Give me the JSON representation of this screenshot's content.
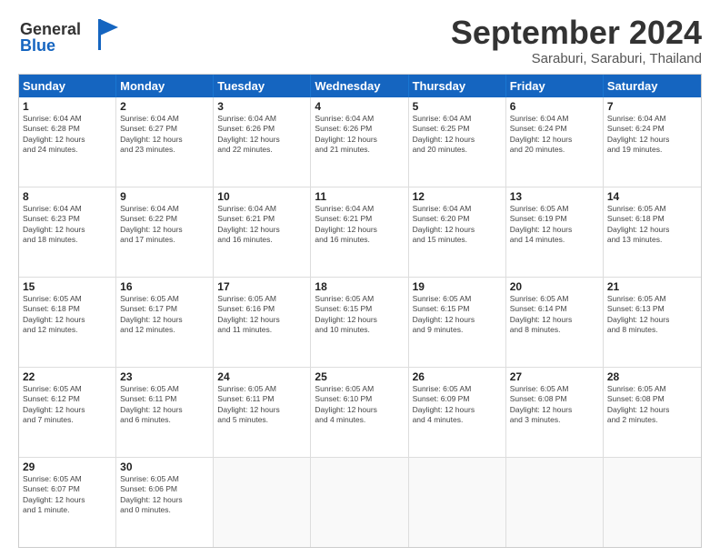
{
  "header": {
    "logo_line1": "General",
    "logo_line2": "Blue",
    "month": "September 2024",
    "location": "Saraburi, Saraburi, Thailand"
  },
  "weekdays": [
    "Sunday",
    "Monday",
    "Tuesday",
    "Wednesday",
    "Thursday",
    "Friday",
    "Saturday"
  ],
  "rows": [
    [
      {
        "day": "",
        "text": ""
      },
      {
        "day": "2",
        "text": "Sunrise: 6:04 AM\nSunset: 6:27 PM\nDaylight: 12 hours\nand 23 minutes."
      },
      {
        "day": "3",
        "text": "Sunrise: 6:04 AM\nSunset: 6:26 PM\nDaylight: 12 hours\nand 22 minutes."
      },
      {
        "day": "4",
        "text": "Sunrise: 6:04 AM\nSunset: 6:26 PM\nDaylight: 12 hours\nand 21 minutes."
      },
      {
        "day": "5",
        "text": "Sunrise: 6:04 AM\nSunset: 6:25 PM\nDaylight: 12 hours\nand 20 minutes."
      },
      {
        "day": "6",
        "text": "Sunrise: 6:04 AM\nSunset: 6:24 PM\nDaylight: 12 hours\nand 20 minutes."
      },
      {
        "day": "7",
        "text": "Sunrise: 6:04 AM\nSunset: 6:24 PM\nDaylight: 12 hours\nand 19 minutes."
      }
    ],
    [
      {
        "day": "8",
        "text": "Sunrise: 6:04 AM\nSunset: 6:23 PM\nDaylight: 12 hours\nand 18 minutes."
      },
      {
        "day": "9",
        "text": "Sunrise: 6:04 AM\nSunset: 6:22 PM\nDaylight: 12 hours\nand 17 minutes."
      },
      {
        "day": "10",
        "text": "Sunrise: 6:04 AM\nSunset: 6:21 PM\nDaylight: 12 hours\nand 16 minutes."
      },
      {
        "day": "11",
        "text": "Sunrise: 6:04 AM\nSunset: 6:21 PM\nDaylight: 12 hours\nand 16 minutes."
      },
      {
        "day": "12",
        "text": "Sunrise: 6:04 AM\nSunset: 6:20 PM\nDaylight: 12 hours\nand 15 minutes."
      },
      {
        "day": "13",
        "text": "Sunrise: 6:05 AM\nSunset: 6:19 PM\nDaylight: 12 hours\nand 14 minutes."
      },
      {
        "day": "14",
        "text": "Sunrise: 6:05 AM\nSunset: 6:18 PM\nDaylight: 12 hours\nand 13 minutes."
      }
    ],
    [
      {
        "day": "15",
        "text": "Sunrise: 6:05 AM\nSunset: 6:18 PM\nDaylight: 12 hours\nand 12 minutes."
      },
      {
        "day": "16",
        "text": "Sunrise: 6:05 AM\nSunset: 6:17 PM\nDaylight: 12 hours\nand 12 minutes."
      },
      {
        "day": "17",
        "text": "Sunrise: 6:05 AM\nSunset: 6:16 PM\nDaylight: 12 hours\nand 11 minutes."
      },
      {
        "day": "18",
        "text": "Sunrise: 6:05 AM\nSunset: 6:15 PM\nDaylight: 12 hours\nand 10 minutes."
      },
      {
        "day": "19",
        "text": "Sunrise: 6:05 AM\nSunset: 6:15 PM\nDaylight: 12 hours\nand 9 minutes."
      },
      {
        "day": "20",
        "text": "Sunrise: 6:05 AM\nSunset: 6:14 PM\nDaylight: 12 hours\nand 8 minutes."
      },
      {
        "day": "21",
        "text": "Sunrise: 6:05 AM\nSunset: 6:13 PM\nDaylight: 12 hours\nand 8 minutes."
      }
    ],
    [
      {
        "day": "22",
        "text": "Sunrise: 6:05 AM\nSunset: 6:12 PM\nDaylight: 12 hours\nand 7 minutes."
      },
      {
        "day": "23",
        "text": "Sunrise: 6:05 AM\nSunset: 6:11 PM\nDaylight: 12 hours\nand 6 minutes."
      },
      {
        "day": "24",
        "text": "Sunrise: 6:05 AM\nSunset: 6:11 PM\nDaylight: 12 hours\nand 5 minutes."
      },
      {
        "day": "25",
        "text": "Sunrise: 6:05 AM\nSunset: 6:10 PM\nDaylight: 12 hours\nand 4 minutes."
      },
      {
        "day": "26",
        "text": "Sunrise: 6:05 AM\nSunset: 6:09 PM\nDaylight: 12 hours\nand 4 minutes."
      },
      {
        "day": "27",
        "text": "Sunrise: 6:05 AM\nSunset: 6:08 PM\nDaylight: 12 hours\nand 3 minutes."
      },
      {
        "day": "28",
        "text": "Sunrise: 6:05 AM\nSunset: 6:08 PM\nDaylight: 12 hours\nand 2 minutes."
      }
    ],
    [
      {
        "day": "29",
        "text": "Sunrise: 6:05 AM\nSunset: 6:07 PM\nDaylight: 12 hours\nand 1 minute."
      },
      {
        "day": "30",
        "text": "Sunrise: 6:05 AM\nSunset: 6:06 PM\nDaylight: 12 hours\nand 0 minutes."
      },
      {
        "day": "",
        "text": ""
      },
      {
        "day": "",
        "text": ""
      },
      {
        "day": "",
        "text": ""
      },
      {
        "day": "",
        "text": ""
      },
      {
        "day": "",
        "text": ""
      }
    ]
  ],
  "row0_day1": {
    "day": "1",
    "text": "Sunrise: 6:04 AM\nSunset: 6:28 PM\nDaylight: 12 hours\nand 24 minutes."
  }
}
